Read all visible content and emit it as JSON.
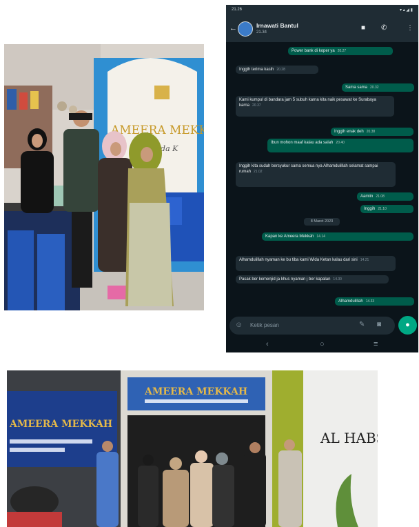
{
  "chat": {
    "status_time": "21.26",
    "status_right": "▾ ▴ ◢ ▮",
    "contact_name": "Irnawati Bantul",
    "contact_sub": "21.34",
    "placeholder": "Ketik pesan",
    "date_chip": "8 Maret 2023",
    "messages": [
      {
        "dir": "out",
        "text": "Power bank di koper ya",
        "time": "20.27"
      },
      {
        "dir": "in",
        "text": "Inggih terima kasih",
        "time": "20.28"
      },
      {
        "dir": "out",
        "text": "Sama sama",
        "time": "20.32"
      },
      {
        "dir": "in",
        "text": "Kami kumpul di bandara jam 5 subuh karna kita naik pesawat ke Surabaya karna",
        "time": "20.37"
      },
      {
        "dir": "out",
        "text": "Inggih enak deh",
        "time": "20.38"
      },
      {
        "dir": "out",
        "text": "Ibun mohon maaf kalau ada salah",
        "time": "20.40"
      },
      {
        "dir": "in",
        "text": "Inggih kita sudah bersyukur sama semua nya Alhamdulillah selamat sampai rumah",
        "time": "21.02"
      },
      {
        "dir": "out",
        "text": "Aamiin",
        "time": "21.08"
      },
      {
        "dir": "out",
        "text": "Inggih",
        "time": "21.10"
      },
      {
        "dir": "out",
        "text": "Kapan ke Ameera Mekkah",
        "time": "14.14"
      },
      {
        "dir": "in",
        "text": "Alhamdulillah nyaman ke bu tiba kami Wida Ketan kalau dari sini",
        "time": "14.21"
      },
      {
        "dir": "in",
        "text": "Pasak ber kemenjid ja khus nyaman j ber kapalan",
        "time": "14.30"
      },
      {
        "dir": "out",
        "text": "Alhamdulillah",
        "time": "14.33"
      }
    ]
  },
  "signs": {
    "office_sign": "AMEERA MEKKAH",
    "office_tagline": "Anda K",
    "front_sign_left": "AMEERA MEKKAH",
    "front_sign_center": "AMEERA MEKKAH",
    "front_wall_text": "AL HABSYI"
  }
}
